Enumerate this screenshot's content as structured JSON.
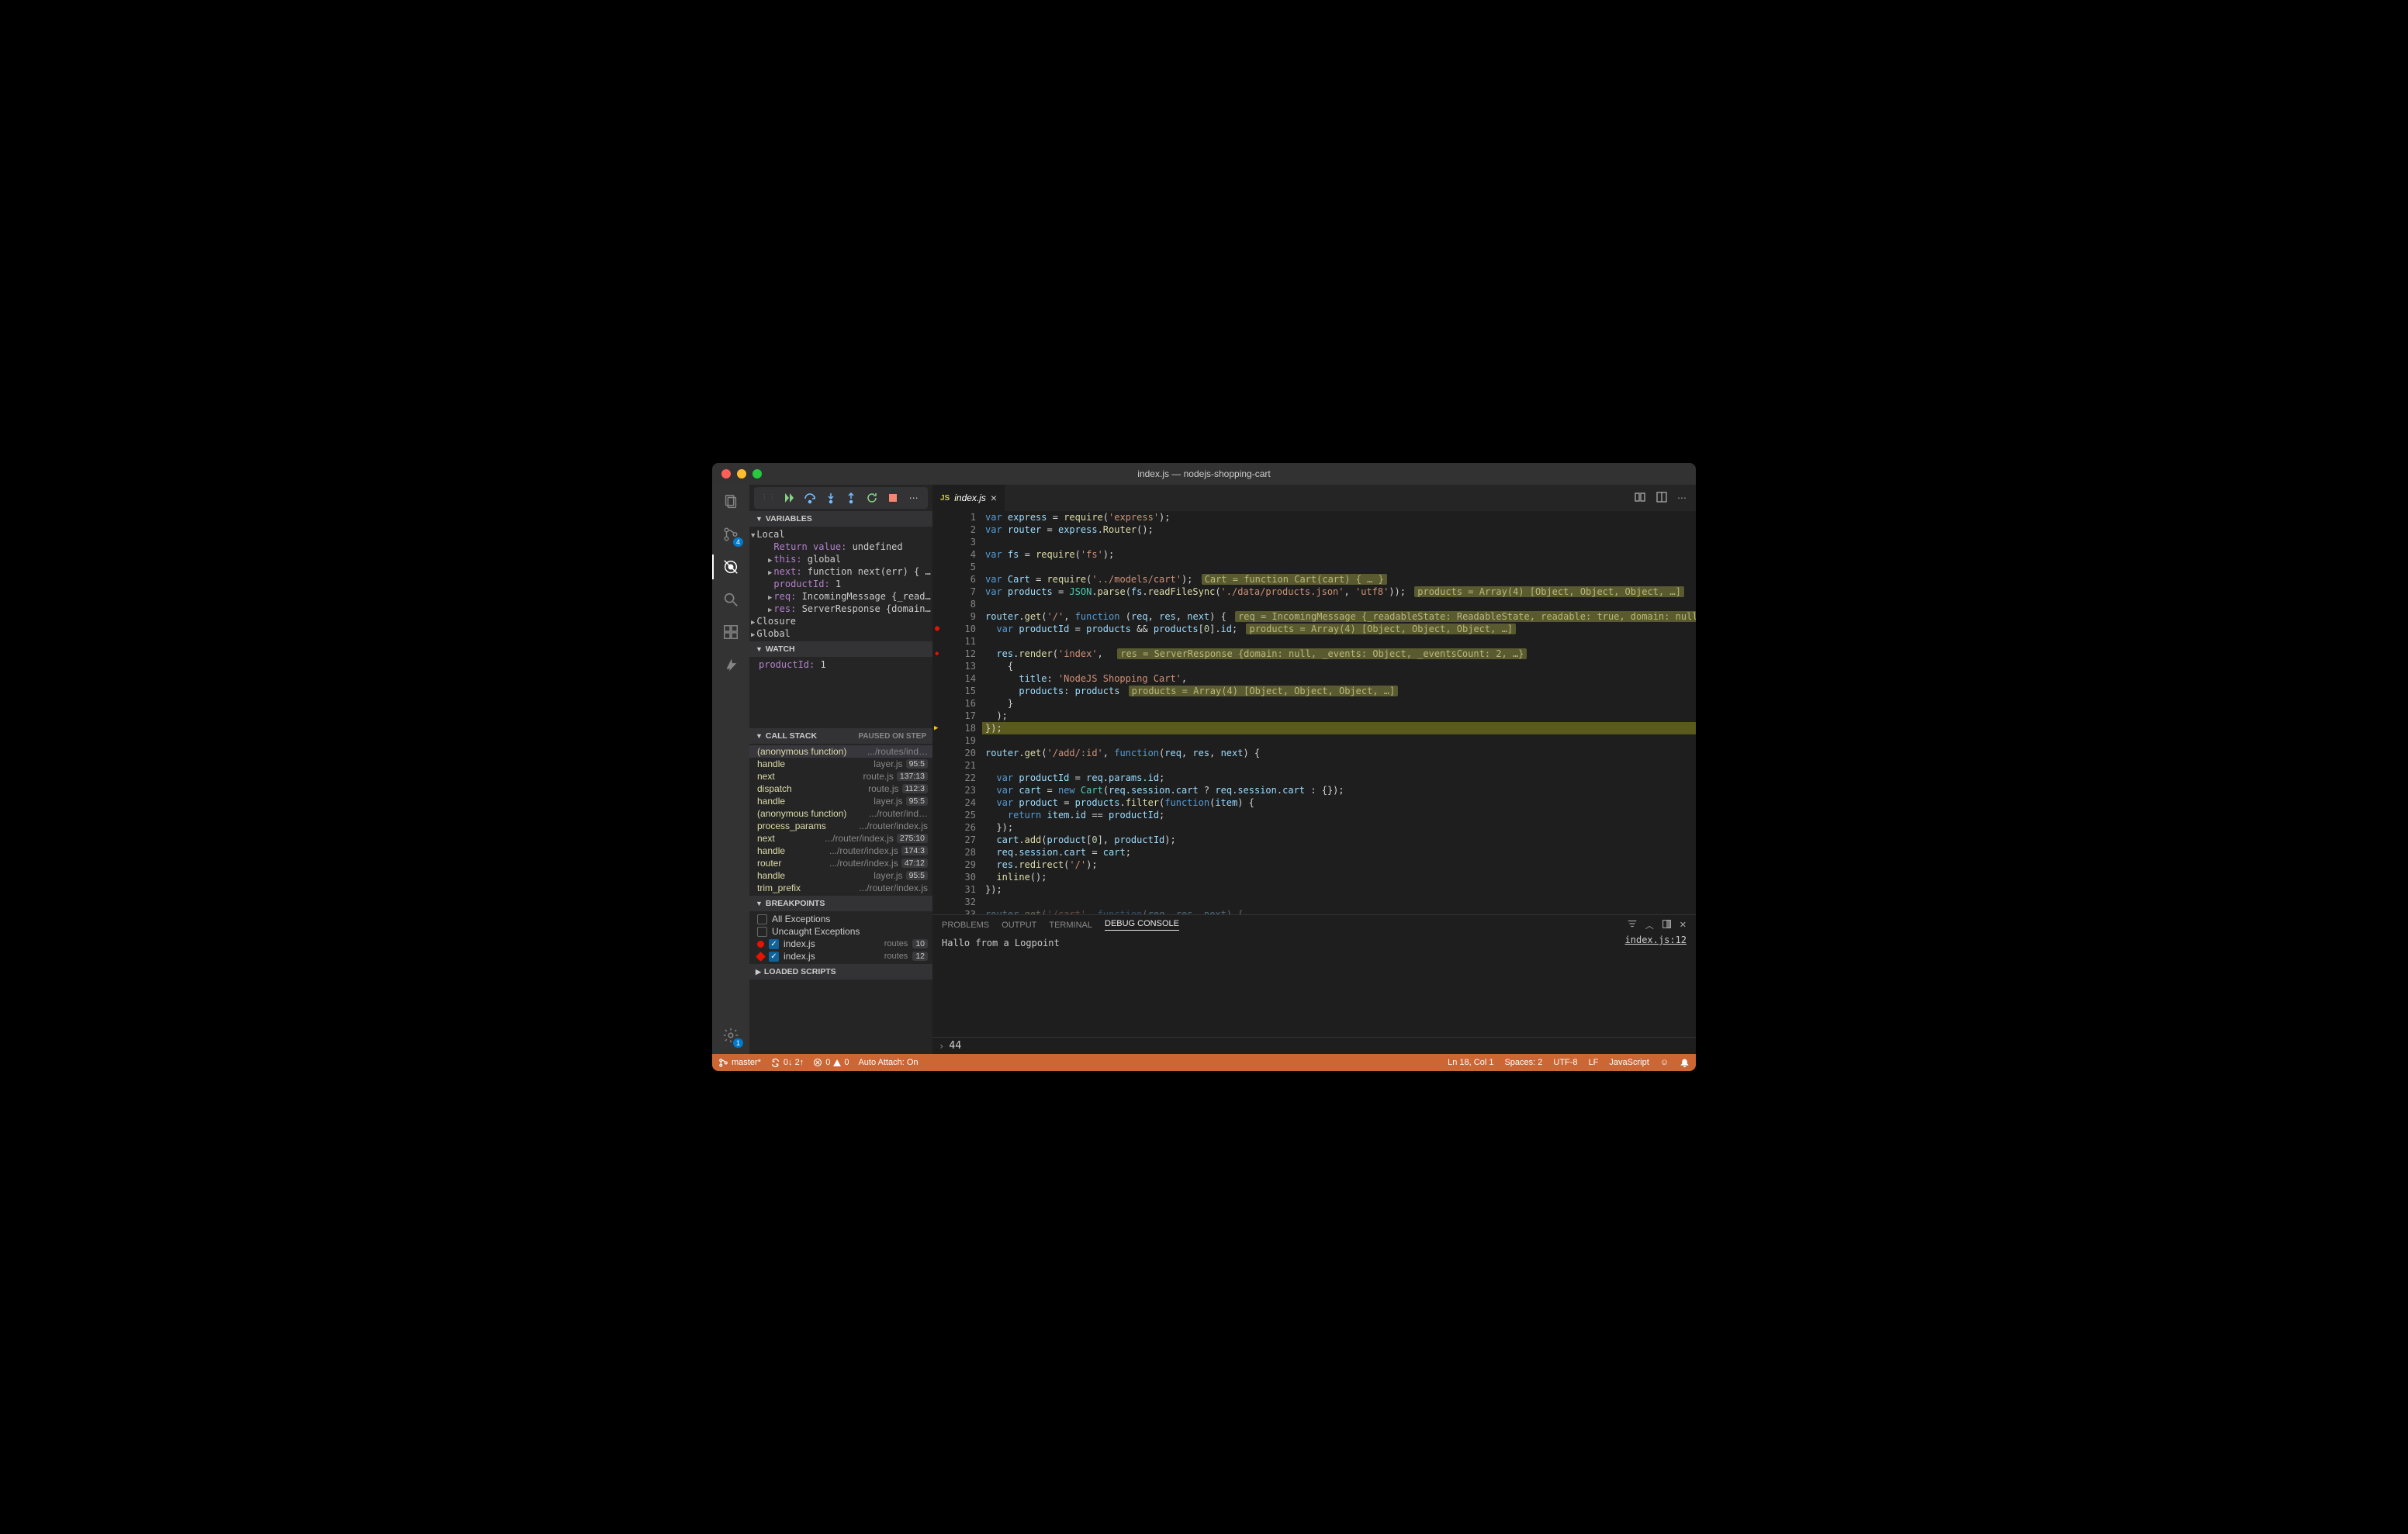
{
  "window_title": "index.js — nodejs-shopping-cart",
  "activity_badges": {
    "scm": "4",
    "settings": "1"
  },
  "debug_toolbar": [
    "continue",
    "step-over",
    "step-into",
    "step-out",
    "restart",
    "stop",
    "more"
  ],
  "tab": {
    "icon": "JS",
    "name": "index.js"
  },
  "sections": {
    "variables": "Variables",
    "watch": "Watch",
    "callstack": "Call Stack",
    "callstack_status": "Paused on step",
    "breakpoints": "Breakpoints",
    "loaded": "Loaded Scripts"
  },
  "variables": {
    "local_label": "Local",
    "items": [
      {
        "k": "Return value:",
        "v": "undefined",
        "chev": false
      },
      {
        "k": "this:",
        "v": "global",
        "chev": true
      },
      {
        "k": "next:",
        "v": "function next(err) { … }",
        "chev": true
      },
      {
        "k": "productId:",
        "v": "1",
        "chev": false
      },
      {
        "k": "req:",
        "v": "IncomingMessage {_readableSt…",
        "chev": true
      },
      {
        "k": "res:",
        "v": "ServerResponse {domain: null…",
        "chev": true
      }
    ],
    "closure": "Closure",
    "global": "Global"
  },
  "watch": [
    {
      "k": "productId:",
      "v": "1"
    }
  ],
  "callstack": [
    {
      "fn": "(anonymous function)",
      "file": ".../routes/ind…",
      "loc": "",
      "sel": true
    },
    {
      "fn": "handle",
      "file": "layer.js",
      "loc": "95:5"
    },
    {
      "fn": "next",
      "file": "route.js",
      "loc": "137:13"
    },
    {
      "fn": "dispatch",
      "file": "route.js",
      "loc": "112:3"
    },
    {
      "fn": "handle",
      "file": "layer.js",
      "loc": "95:5"
    },
    {
      "fn": "(anonymous function)",
      "file": ".../router/ind…",
      "loc": ""
    },
    {
      "fn": "process_params",
      "file": ".../router/index.js",
      "loc": ""
    },
    {
      "fn": "next",
      "file": ".../router/index.js",
      "loc": "275:10"
    },
    {
      "fn": "handle",
      "file": ".../router/index.js",
      "loc": "174:3"
    },
    {
      "fn": "router",
      "file": ".../router/index.js",
      "loc": "47:12"
    },
    {
      "fn": "handle",
      "file": "layer.js",
      "loc": "95:5"
    },
    {
      "fn": "trim_prefix",
      "file": ".../router/index.js",
      "loc": ""
    }
  ],
  "breakpoints": {
    "all": "All Exceptions",
    "uncaught": "Uncaught Exceptions",
    "items": [
      {
        "file": "index.js",
        "tag": "routes",
        "line": "10",
        "diamond": false
      },
      {
        "file": "index.js",
        "tag": "routes",
        "line": "12",
        "diamond": true
      }
    ]
  },
  "panel": {
    "tabs": [
      "Problems",
      "Output",
      "Terminal",
      "Debug Console"
    ],
    "active": 3,
    "msg": "Hallo from a Logpoint",
    "link": "index.js:12",
    "repl": "44"
  },
  "status": {
    "branch": "master*",
    "sync": "0↓ 2↑",
    "errwarn_err": "0",
    "errwarn_warn": "0",
    "autoattach": "Auto Attach: On",
    "ln": "Ln 18, Col 1",
    "spaces": "Spaces: 2",
    "enc": "UTF-8",
    "eol": "LF",
    "lang": "JavaScript"
  },
  "code": {
    "lines": [
      {
        "n": 1,
        "html": "<span class='k1'>var</span> <span class='vr'>express</span> <span class='pn'>=</span> <span class='fn'>require</span><span class='pn'>(</span><span class='str'>'express'</span><span class='pn'>);</span>"
      },
      {
        "n": 2,
        "html": "<span class='k1'>var</span> <span class='vr'>router</span> <span class='pn'>=</span> <span class='vr'>express</span><span class='pn'>.</span><span class='fn'>Router</span><span class='pn'>();</span>"
      },
      {
        "n": 3,
        "html": ""
      },
      {
        "n": 4,
        "html": "<span class='k1'>var</span> <span class='vr'>fs</span> <span class='pn'>=</span> <span class='fn'>require</span><span class='pn'>(</span><span class='str'>'fs'</span><span class='pn'>);</span>"
      },
      {
        "n": 5,
        "html": ""
      },
      {
        "n": 6,
        "html": "<span class='k1'>var</span> <span class='vr'>Cart</span> <span class='pn'>=</span> <span class='fn'>require</span><span class='pn'>(</span><span class='str'>'../models/cart'</span><span class='pn'>);</span> <span class='inlay'>Cart = function Cart(cart) { … }</span>"
      },
      {
        "n": 7,
        "html": "<span class='k1'>var</span> <span class='vr'>products</span> <span class='pn'>=</span> <span class='k2'>JSON</span><span class='pn'>.</span><span class='fn'>parse</span><span class='pn'>(</span><span class='vr'>fs</span><span class='pn'>.</span><span class='fn'>readFileSync</span><span class='pn'>(</span><span class='str'>'./data/products.json'</span><span class='pn'>,</span> <span class='str'>'utf8'</span><span class='pn'>));</span> <span class='inlay'>products = Array(4) [Object, Object, Object, …]</span>"
      },
      {
        "n": 8,
        "html": ""
      },
      {
        "n": 9,
        "html": "<span class='vr'>router</span><span class='pn'>.</span><span class='fn'>get</span><span class='pn'>(</span><span class='str'>'/'</span><span class='pn'>,</span> <span class='k1'>function</span> <span class='pn'>(</span><span class='vr'>req</span><span class='pn'>,</span> <span class='vr'>res</span><span class='pn'>,</span> <span class='vr'>next</span><span class='pn'>) {</span> <span class='inlay'>req = IncomingMessage {_readableState: ReadableState, readable: true, domain: null, …}, res = ServerRes</span>"
      },
      {
        "n": 10,
        "glyph": "bp",
        "html": "  <span class='k1'>var</span> <span class='vr'>productId</span> <span class='pn'>=</span> <span class='vr'>products</span> <span class='pn'>&amp;&amp;</span> <span class='vr'>products</span><span class='pn'>[</span><span class='nm'>0</span><span class='pn'>].</span><span class='vr'>id</span><span class='pn'>;</span> <span class='inlay'>products = Array(4) [Object, Object, Object, …]</span>"
      },
      {
        "n": 11,
        "html": ""
      },
      {
        "n": 12,
        "glyph": "bpd",
        "html": "  <span class='vr'>res</span><span class='pn'>.</span><span class='fn'>render</span><span class='pn'>(</span><span class='str'>'index'</span><span class='pn'>,</span>  <span class='inlay'>res = ServerResponse {domain: null, _events: Object, _eventsCount: 2, …}</span>"
      },
      {
        "n": 13,
        "html": "    <span class='pn'>{</span>"
      },
      {
        "n": 14,
        "html": "      <span class='vr'>title</span><span class='pn'>:</span> <span class='str'>'NodeJS Shopping Cart'</span><span class='pn'>,</span>"
      },
      {
        "n": 15,
        "html": "      <span class='vr'>products</span><span class='pn'>:</span> <span class='vr'>products</span> <span class='inlay'>products = Array(4) [Object, Object, Object, …]</span>"
      },
      {
        "n": 16,
        "html": "    <span class='pn'>}</span>"
      },
      {
        "n": 17,
        "html": "  <span class='pn'>);</span>"
      },
      {
        "n": 18,
        "glyph": "arrow",
        "hl": true,
        "html": "<span class='pn'>});</span>"
      },
      {
        "n": 19,
        "html": ""
      },
      {
        "n": 20,
        "html": "<span class='vr'>router</span><span class='pn'>.</span><span class='fn'>get</span><span class='pn'>(</span><span class='str'>'/add/:id'</span><span class='pn'>,</span> <span class='k1'>function</span><span class='pn'>(</span><span class='vr'>req</span><span class='pn'>,</span> <span class='vr'>res</span><span class='pn'>,</span> <span class='vr'>next</span><span class='pn'>) {</span>"
      },
      {
        "n": 21,
        "html": ""
      },
      {
        "n": 22,
        "html": "  <span class='k1'>var</span> <span class='vr'>productId</span> <span class='pn'>=</span> <span class='vr'>req</span><span class='pn'>.</span><span class='vr'>params</span><span class='pn'>.</span><span class='vr'>id</span><span class='pn'>;</span>"
      },
      {
        "n": 23,
        "html": "  <span class='k1'>var</span> <span class='vr'>cart</span> <span class='pn'>=</span> <span class='k1'>new</span> <span class='k2'>Cart</span><span class='pn'>(</span><span class='vr'>req</span><span class='pn'>.</span><span class='vr'>session</span><span class='pn'>.</span><span class='vr'>cart</span> <span class='pn'>?</span> <span class='vr'>req</span><span class='pn'>.</span><span class='vr'>session</span><span class='pn'>.</span><span class='vr'>cart</span> <span class='pn'>:</span> <span class='pn'>{});</span>"
      },
      {
        "n": 24,
        "html": "  <span class='k1'>var</span> <span class='vr'>product</span> <span class='pn'>=</span> <span class='vr'>products</span><span class='pn'>.</span><span class='fn'>filter</span><span class='pn'>(</span><span class='k1'>function</span><span class='pn'>(</span><span class='vr'>item</span><span class='pn'>) {</span>"
      },
      {
        "n": 25,
        "html": "    <span class='k1'>return</span> <span class='vr'>item</span><span class='pn'>.</span><span class='vr'>id</span> <span class='pn'>==</span> <span class='vr'>productId</span><span class='pn'>;</span>"
      },
      {
        "n": 26,
        "html": "  <span class='pn'>});</span>"
      },
      {
        "n": 27,
        "html": "  <span class='vr'>cart</span><span class='pn'>.</span><span class='fn'>add</span><span class='pn'>(</span><span class='vr'>product</span><span class='pn'>[</span><span class='nm'>0</span><span class='pn'>],</span> <span class='vr'>productId</span><span class='pn'>);</span>"
      },
      {
        "n": 28,
        "html": "  <span class='vr'>req</span><span class='pn'>.</span><span class='vr'>session</span><span class='pn'>.</span><span class='vr'>cart</span> <span class='pn'>=</span> <span class='vr'>cart</span><span class='pn'>;</span>"
      },
      {
        "n": 29,
        "html": "  <span class='vr'>res</span><span class='pn'>.</span><span class='fn'>redirect</span><span class='pn'>(</span><span class='str'>'/'</span><span class='pn'>);</span>"
      },
      {
        "n": 30,
        "html": "  <span class='fn'>inline</span><span class='pn'>();</span>"
      },
      {
        "n": 31,
        "html": "<span class='pn'>});</span>"
      },
      {
        "n": 32,
        "html": ""
      },
      {
        "n": 33,
        "dim": true,
        "html": "<span class='vr' style='opacity:.4'>router</span><span class='pn' style='opacity:.4'>.</span><span class='fn' style='opacity:.4'>get</span><span class='pn' style='opacity:.4'>(</span><span class='str' style='opacity:.4'>'/cart'</span><span class='pn' style='opacity:.4'>,</span> <span class='k1' style='opacity:.4'>function</span><span class='pn' style='opacity:.4'>(</span><span class='vr' style='opacity:.4'>req</span><span class='pn' style='opacity:.4'>,</span> <span class='vr' style='opacity:.4'>res</span><span class='pn' style='opacity:.4'>,</span> <span class='vr' style='opacity:.4'>next</span><span class='pn' style='opacity:.4'>) {</span>"
      }
    ]
  }
}
